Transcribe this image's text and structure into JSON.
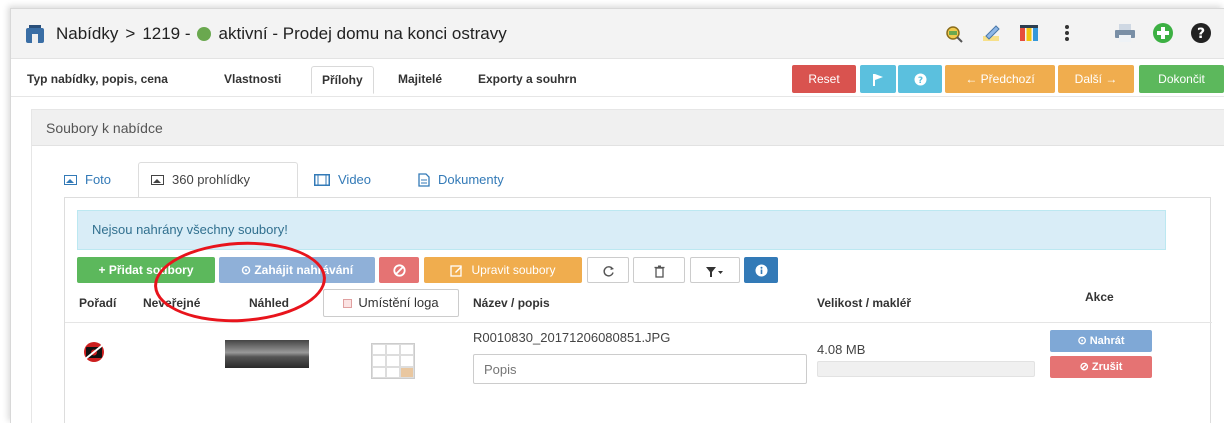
{
  "window": {
    "breadcrumb_root": "Nabídky",
    "breadcrumb_sep": ">",
    "offer_id": "1219 -",
    "status_label": "aktivní - Prodej domu na konci ostravy",
    "status_color": "#6aa84f"
  },
  "toolbar_icons": [
    "search-map-icon",
    "edit-icon",
    "columns-icon",
    "more-icon",
    "print-icon",
    "add-icon",
    "help-icon"
  ],
  "nav": {
    "tabs": [
      {
        "label": "Typ nabídky, popis, cena"
      },
      {
        "label": "Vlastnosti"
      },
      {
        "label": "Přílohy",
        "active": true
      },
      {
        "label": "Majitelé"
      },
      {
        "label": "Exporty a souhrn"
      }
    ],
    "reset_label": "Reset",
    "prev_label": "← Předchozí",
    "next_label": "Další →",
    "finish_label": "Dokončit"
  },
  "panel": {
    "heading": "Soubory k nabídce",
    "subtabs": [
      {
        "label": "Foto"
      },
      {
        "label": "360 prohlídky",
        "active": true
      },
      {
        "label": "Video"
      },
      {
        "label": "Dokumenty"
      }
    ],
    "alert": "Nejsou nahrány všechny soubory!",
    "buttons": {
      "add": "+ Přidat soubory",
      "start": "⊙ Zahájit nahrávání",
      "edit": "Upravit soubory"
    },
    "columns": {
      "order": "Pořadí",
      "private": "Neveřejné",
      "preview": "Náhled",
      "logo_position": "Umístění loga",
      "name": "Název / popis",
      "size": "Velikost / makléř",
      "actions": "Akce"
    },
    "file": {
      "name": "R0010830_20171206080851.JPG",
      "description_placeholder": "Popis",
      "size": "4.08 MB",
      "upload_progress": 0,
      "upload_label": "⊙ Nahrát",
      "cancel_label": "⊘ Zrušit"
    }
  },
  "colors": {
    "success": "#5cb85c",
    "info": "#5bc0de",
    "primary_light": "#7fa8d6",
    "danger": "#d9534f",
    "danger_light": "#e57373",
    "warning": "#f0ad4e",
    "link": "#337ab7",
    "annotation": "#e8141c"
  }
}
